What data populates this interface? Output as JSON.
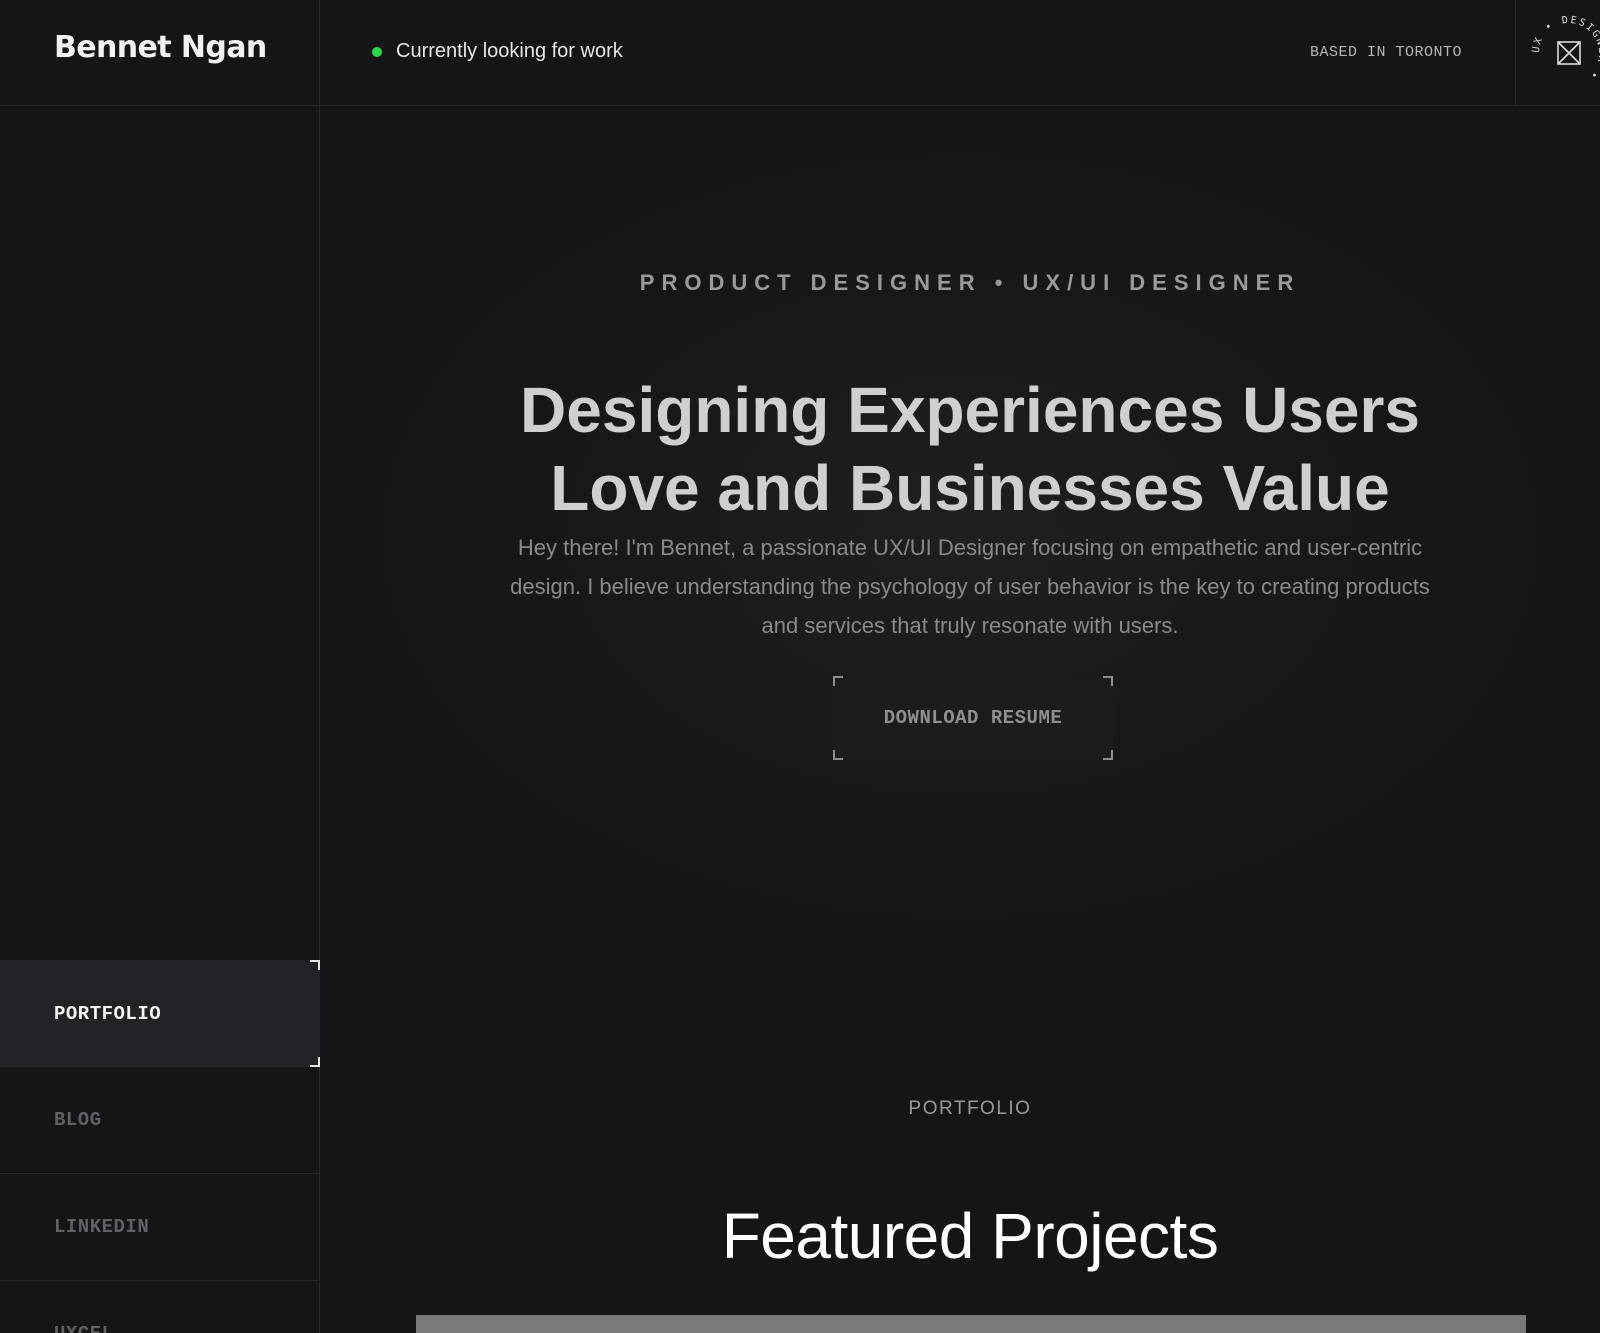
{
  "header": {
    "brand": "Bennet Ngan",
    "status": "Currently looking for work",
    "location": "BASED IN TORONTO",
    "badge_text": "UX • DESIGNER •"
  },
  "sidebar": {
    "items": [
      {
        "label": "PORTFOLIO",
        "active": true
      },
      {
        "label": "BLOG",
        "active": false
      },
      {
        "label": "LINKEDIN",
        "active": false
      },
      {
        "label": "UXCEL",
        "active": false
      }
    ]
  },
  "hero": {
    "eyebrow": "PRODUCT DESIGNER • UX/UI DESIGNER",
    "headline_line1": "Designing Experiences Users",
    "headline_line2": "Love and Businesses Value",
    "intro": "Hey there! I'm Bennet, a passionate UX/UI Designer focusing on empathetic and user-centric design. I believe understanding the psychology of user behavior is the key to creating products and services that truly resonate with users.",
    "cta": "DOWNLOAD RESUME"
  },
  "portfolio": {
    "label": "PORTFOLIO",
    "title": "Featured Projects"
  },
  "colors": {
    "background": "#151517",
    "status_dot": "#2dd64a",
    "active_nav": "#222326"
  }
}
